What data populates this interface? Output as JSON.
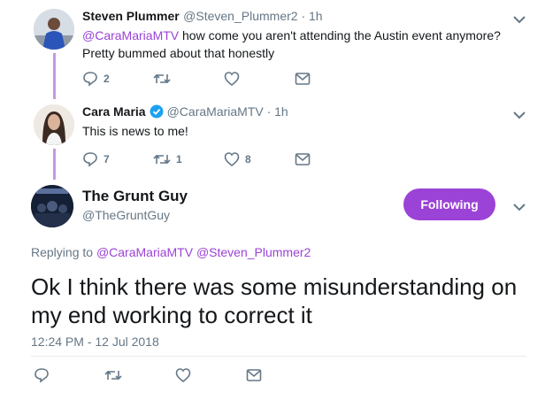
{
  "tweets": [
    {
      "name": "Steven Plummer",
      "handle": "@Steven_Plummer2 · 1h",
      "mention": "@CaraMariaMTV",
      "text_rest": " how come you aren't attending the Austin event anymore?",
      "text_line2": "Pretty bummed about that honestly",
      "reply_count": "2",
      "retweet_count": "",
      "like_count": ""
    },
    {
      "name": "Cara Maria",
      "handle": "@CaraMariaMTV · 1h",
      "text": "This is news to me!",
      "reply_count": "7",
      "retweet_count": "1",
      "like_count": "8",
      "verified": true
    }
  ],
  "main_tweet": {
    "name": "The Grunt Guy",
    "handle": "@TheGruntGuy",
    "follow_label": "Following",
    "replying_prefix": "Replying to ",
    "replying_to_1": "@CaraMariaMTV",
    "replying_to_2": "@Steven_Plummer2",
    "text": "Ok I think there was some misunderstanding on my end working to correct it",
    "timestamp": "12:24 PM - 12 Jul 2018"
  },
  "colors": {
    "accent": "#9b42d7",
    "thread_line": "#c599e6",
    "muted": "#657786",
    "verified": "#1da1f2"
  },
  "icons": [
    "reply-icon",
    "retweet-icon",
    "like-icon",
    "message-icon",
    "chevron-down-icon",
    "verified-icon"
  ]
}
